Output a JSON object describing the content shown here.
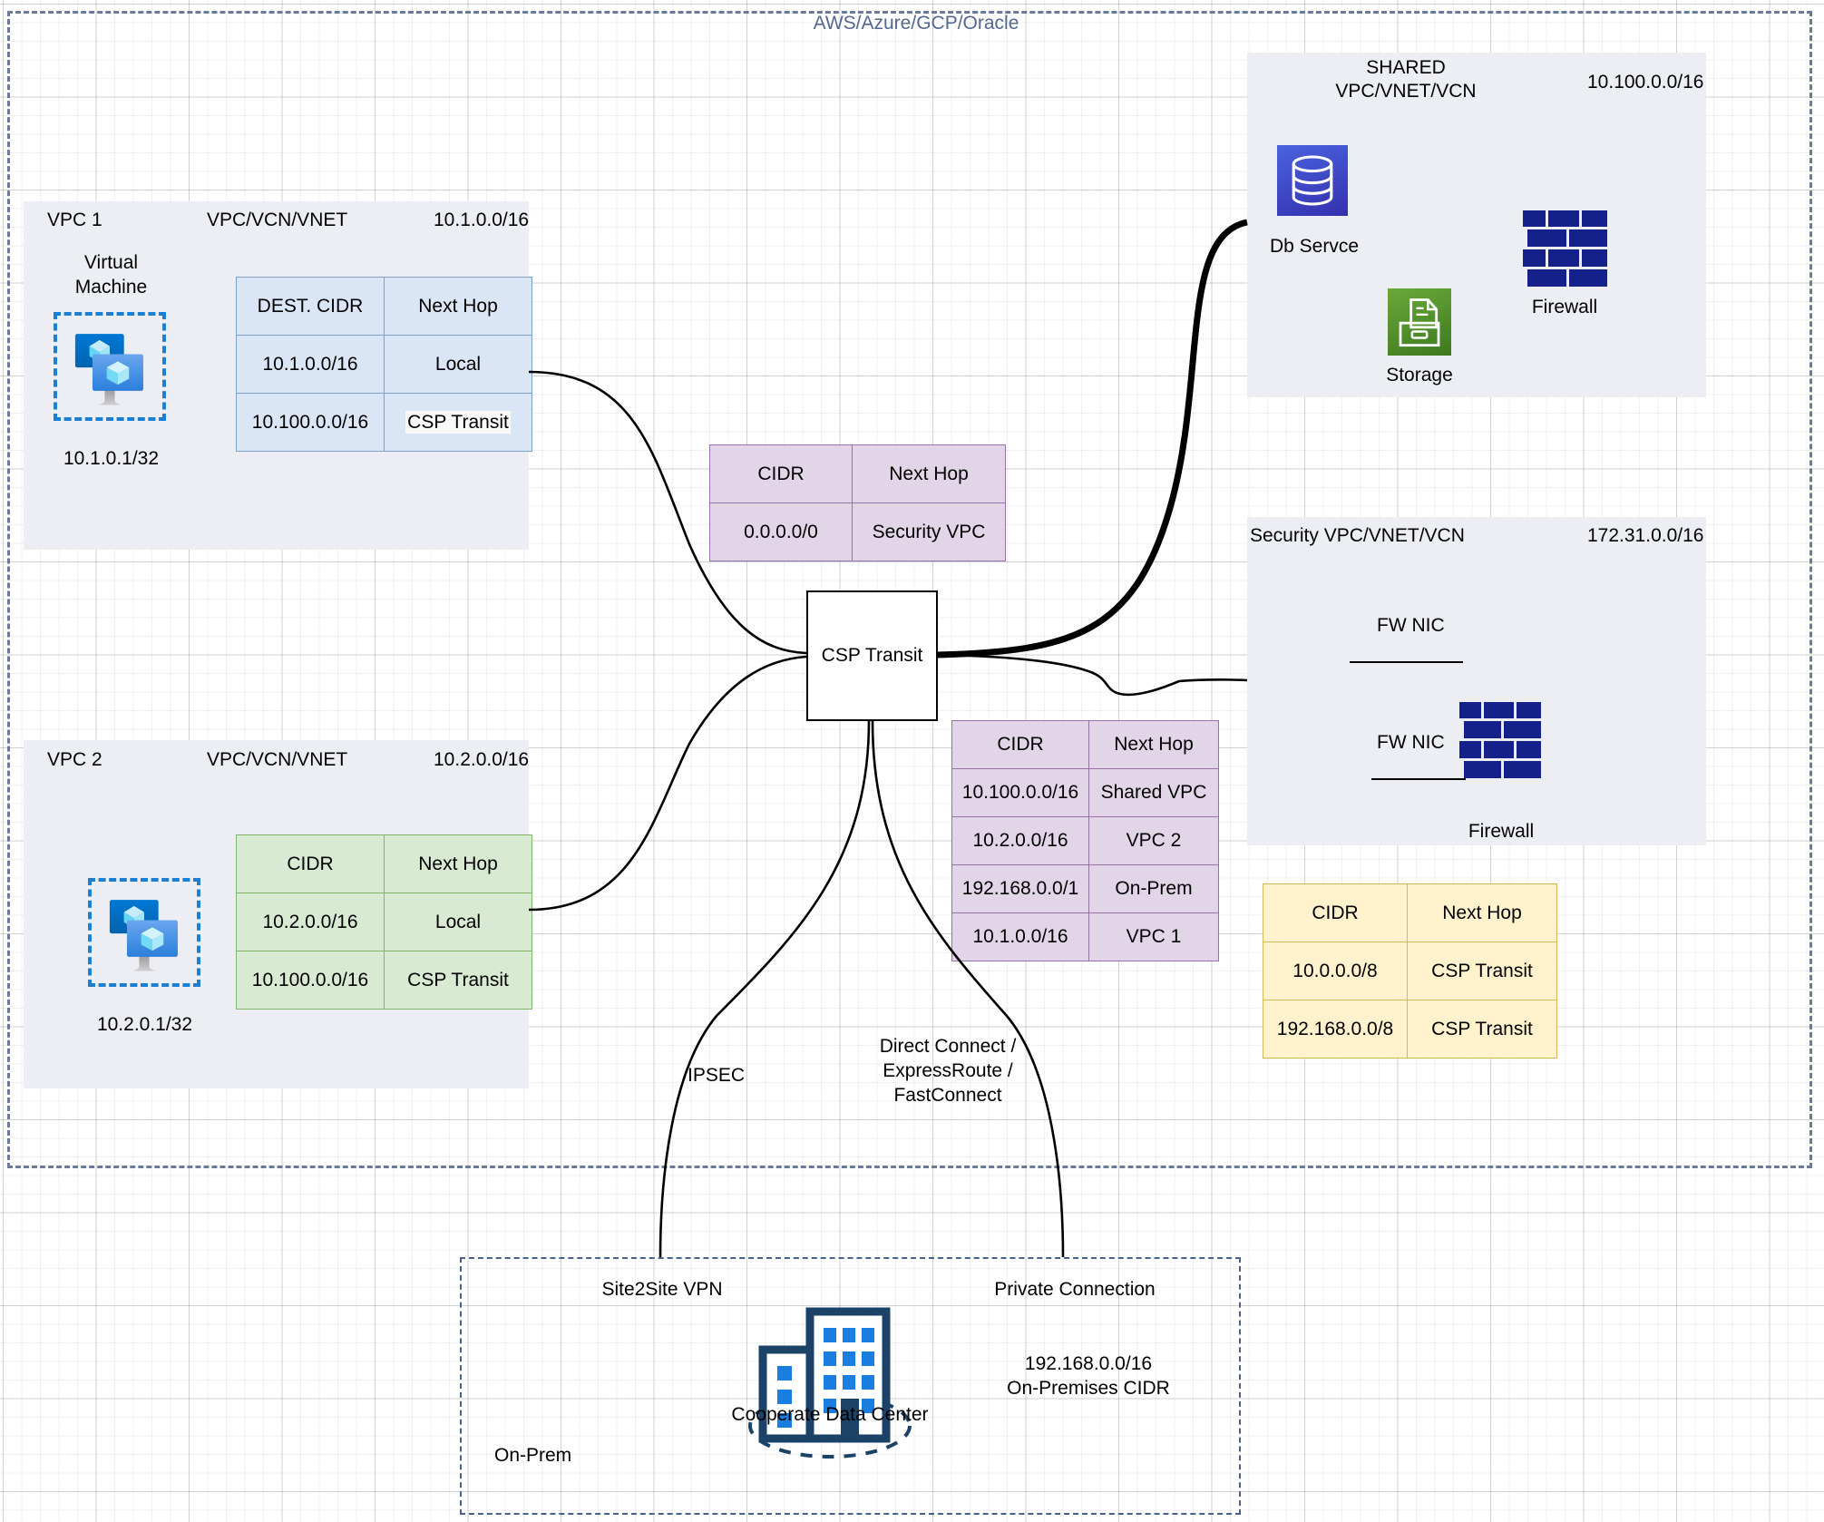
{
  "cloud": {
    "title": "AWS/Azure/GCP/Oracle"
  },
  "vpc1": {
    "name": "VPC 1",
    "type_label": "VPC/VCN/VNET",
    "cidr": "10.1.0.0/16",
    "vm_label": "Virtual\nMachine",
    "vm_icon": "virtual-machine-icon",
    "vm_ip": "10.1.0.1/32",
    "route_table": {
      "headers": [
        "DEST. CIDR",
        "Next Hop"
      ],
      "rows": [
        [
          "10.1.0.0/16",
          "Local"
        ],
        [
          "10.100.0.0/16",
          "CSP Transit"
        ]
      ]
    }
  },
  "vpc2": {
    "name": "VPC 2",
    "type_label": "VPC/VCN/VNET",
    "cidr": "10.2.0.0/16",
    "vm_icon": "virtual-machine-icon",
    "vm_ip": "10.2.0.1/32",
    "route_table": {
      "headers": [
        "CIDR",
        "Next Hop"
      ],
      "rows": [
        [
          "10.2.0.0/16",
          "Local"
        ],
        [
          "10.100.0.0/16",
          "CSP Transit"
        ]
      ]
    }
  },
  "shared_vpc": {
    "name": "SHARED\nVPC/VNET/VCN",
    "cidr": "10.100.0.0/16",
    "db_label": "Db Servce",
    "db_icon": "database-icon",
    "storage_label": "Storage",
    "storage_icon": "storage-icon",
    "firewall_label": "Firewall",
    "firewall_icon": "firewall-icon"
  },
  "security_vpc": {
    "name": "Security VPC/VNET/VCN",
    "cidr": "172.31.0.0/16",
    "nic1_label": "FW NIC",
    "nic2_label": "FW NIC",
    "firewall_label": "Firewall",
    "firewall_icon": "firewall-icon"
  },
  "csp_transit": {
    "label": "CSP Transit"
  },
  "default_route_table": {
    "headers": [
      "CIDR",
      "Next Hop"
    ],
    "rows": [
      [
        "0.0.0.0/0",
        "Security VPC"
      ]
    ]
  },
  "transit_route_table": {
    "headers": [
      "CIDR",
      "Next Hop"
    ],
    "rows": [
      [
        "10.100.0.0/16",
        "Shared VPC"
      ],
      [
        "10.2.0.0/16",
        "VPC 2"
      ],
      [
        "192.168.0.0/1",
        "On-Prem"
      ],
      [
        "10.1.0.0/16",
        "VPC 1"
      ]
    ]
  },
  "security_route_table": {
    "headers": [
      "CIDR",
      "Next Hop"
    ],
    "rows": [
      [
        "10.0.0.0/8",
        "CSP Transit"
      ],
      [
        "192.168.0.0/8",
        "CSP Transit"
      ]
    ]
  },
  "connections": {
    "ipsec": "IPSEC",
    "private": "Direct Connect /\nExpressRoute /\nFastConnect",
    "site2site": "Site2Site VPN",
    "private_connection": "Private Connection"
  },
  "onprem": {
    "box_label": "On-Prem",
    "dc_label": "Cooperate Data Center",
    "dc_icon": "office-building-icon",
    "cidr": "192.168.0.0/16",
    "cidr_label": "On-Premises CIDR"
  },
  "colors": {
    "cloud_border": "#6b7a99",
    "cloud_title": "#54688f",
    "panel_bg": "#eceef4",
    "blue_table": "#dae5f5",
    "green_table": "#d9ead3",
    "purple_table": "#e1d5e7",
    "yellow_table": "#fff2cc",
    "firewall_blue": "#14218a",
    "storage_green": "#4c8c2b",
    "db_blue": "#3a3fc4"
  }
}
